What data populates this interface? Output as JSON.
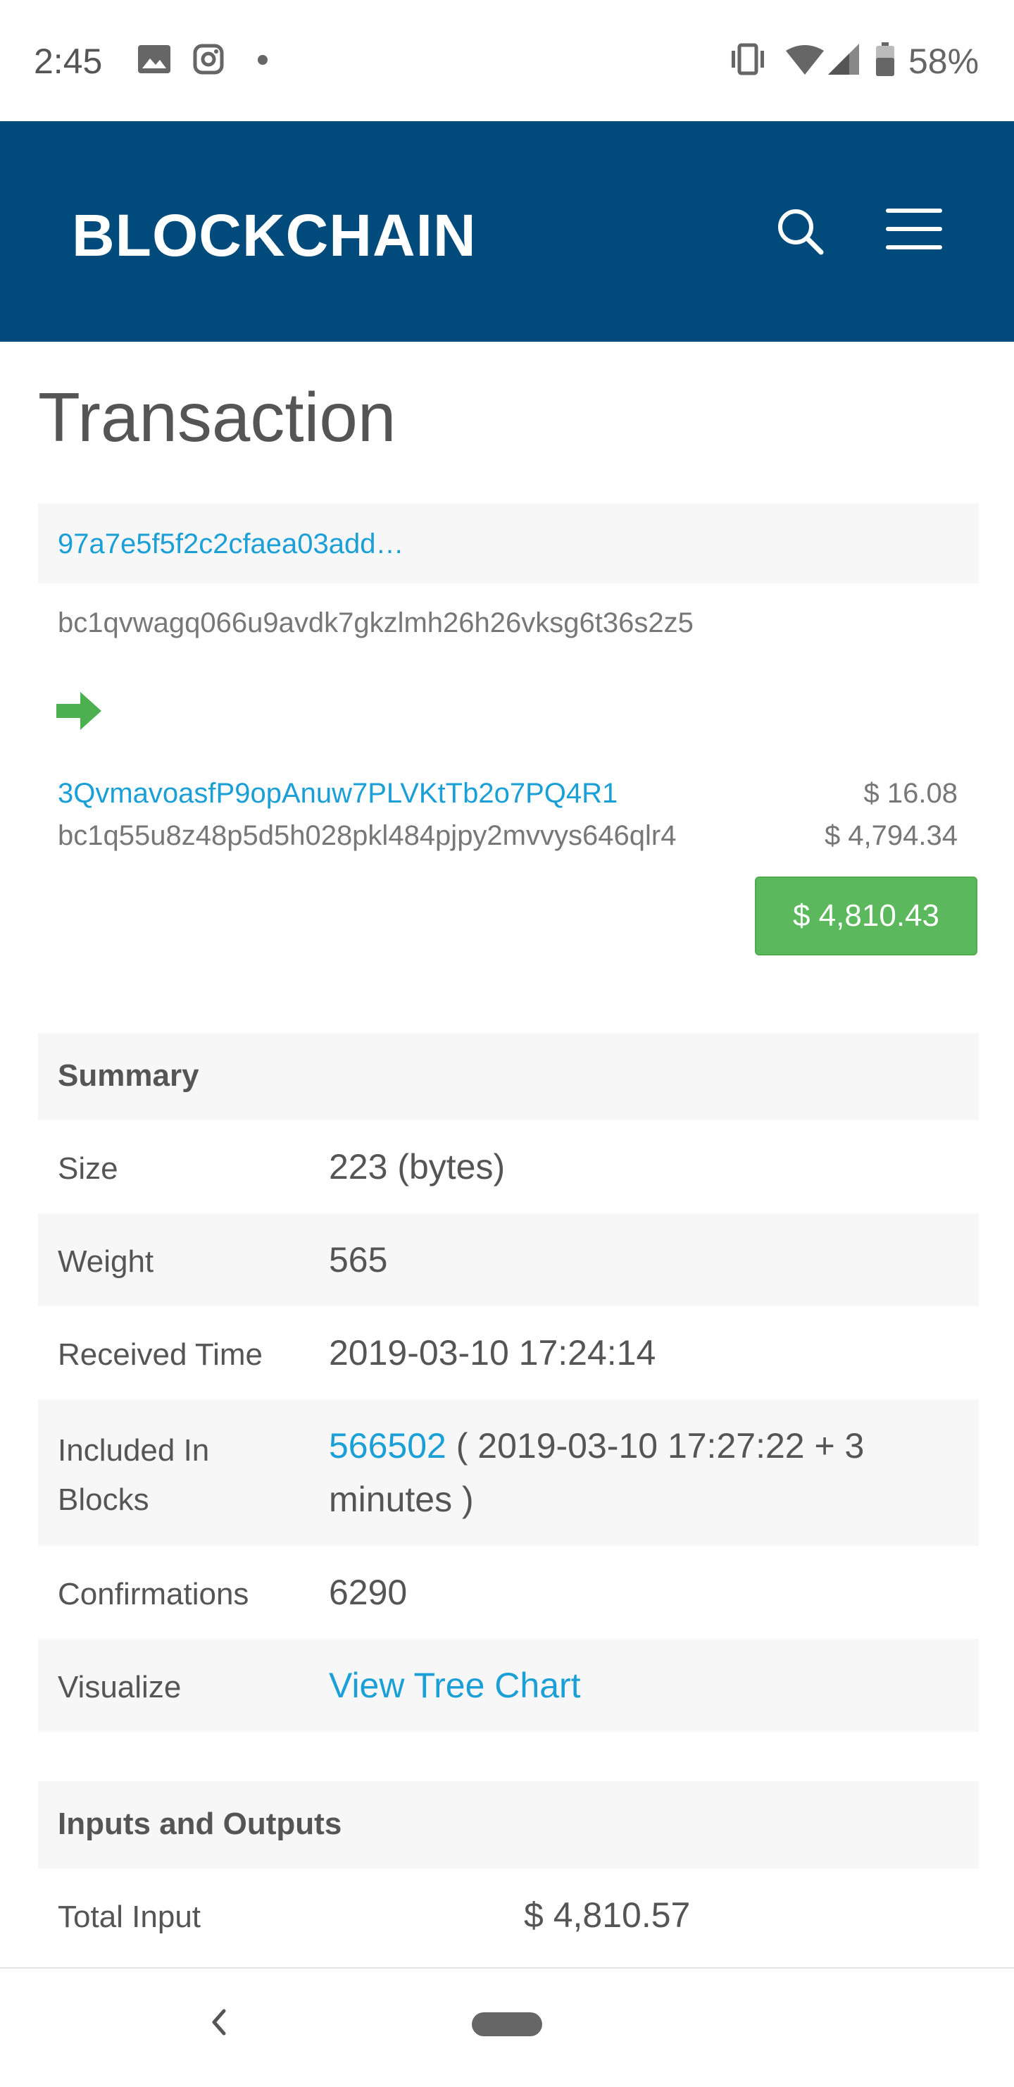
{
  "status_bar": {
    "time": "2:45",
    "battery": "58%"
  },
  "header": {
    "logo": "BLOCKCHAIN"
  },
  "page": {
    "title": "Transaction"
  },
  "transaction": {
    "hash": "97a7e5f5f2c2cfaea03add…",
    "from_address": "bc1qvwagq066u9avdk7gkzlmh26h26vksg6t36s2z5",
    "outputs": [
      {
        "address": "3QvmavoasfP9opAnuw7PLVKtTb2o7PQ4R1",
        "amount": "$ 16.08"
      },
      {
        "address": "bc1q55u8z48p5d5h028pkl484pjpy2mvvys646qlr4",
        "amount": "$ 4,794.34"
      }
    ],
    "total": "$ 4,810.43"
  },
  "summary": {
    "heading": "Summary",
    "size_label": "Size",
    "size_value": "223 (bytes)",
    "weight_label": "Weight",
    "weight_value": "565",
    "received_label": "Received Time",
    "received_value": "2019-03-10 17:24:14",
    "included_label_1": "Included In",
    "included_label_2": "Blocks",
    "included_block": "566502",
    "included_rest_1": " ( 2019-03-10 17:27:22 + 3",
    "included_rest_2": "minutes )",
    "confirmations_label": "Confirmations",
    "confirmations_value": "6290",
    "visualize_label": "Visualize",
    "visualize_link": "View Tree Chart"
  },
  "io": {
    "heading": "Inputs and Outputs",
    "total_input_label": "Total Input",
    "total_input_value": "$ 4,810.57"
  },
  "colors": {
    "header_bg": "#004a7c",
    "link": "#1a9fd6",
    "success": "#5cb85c"
  }
}
